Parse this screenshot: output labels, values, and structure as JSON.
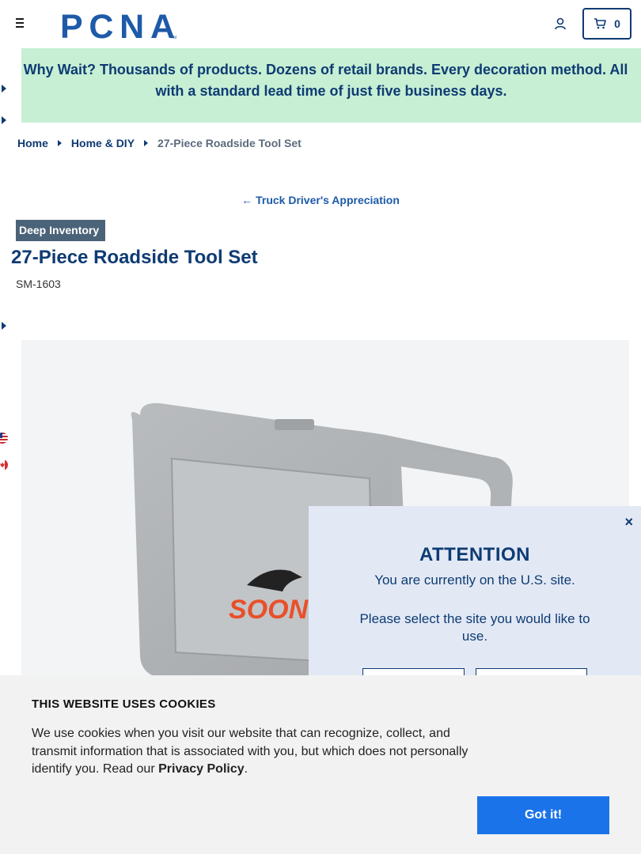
{
  "header": {
    "logo_text": "PCNA",
    "cart_count": "0"
  },
  "promo": {
    "line1": "Why Wait? Thousands of products. Dozens of retail brands. Every decoration method. All",
    "line2": "with a standard lead time of just five business days."
  },
  "breadcrumb": {
    "items": [
      "Home",
      "Home & DIY"
    ],
    "current": "27-Piece Roadside Tool Set"
  },
  "back_link": "Truck Driver's Appreciation",
  "product": {
    "badge": "Deep Inventory",
    "title": "27-Piece Roadside Tool Set",
    "sku": "SM-1603",
    "image_logo_text": "SOON"
  },
  "modal": {
    "close": "×",
    "title": "ATTENTION",
    "message": "You are currently on the U.S. site.",
    "message2": "Please select the site you would like to use."
  },
  "cookie": {
    "title": "THIS WEBSITE USES COOKIES",
    "text": "We use cookies when you visit our website that can recognize, collect, and transmit information that is associated with you, but which does not personally identify you. Read our",
    "link": "Privacy Policy",
    "period": ".",
    "button": "Got it!"
  },
  "colors": {
    "brand_navy": "#0f3b73",
    "promo_bg": "#c6efd4",
    "badge_bg": "#4b6378",
    "modal_bg": "#e2e9f5",
    "cookie_button": "#1a73e8"
  }
}
